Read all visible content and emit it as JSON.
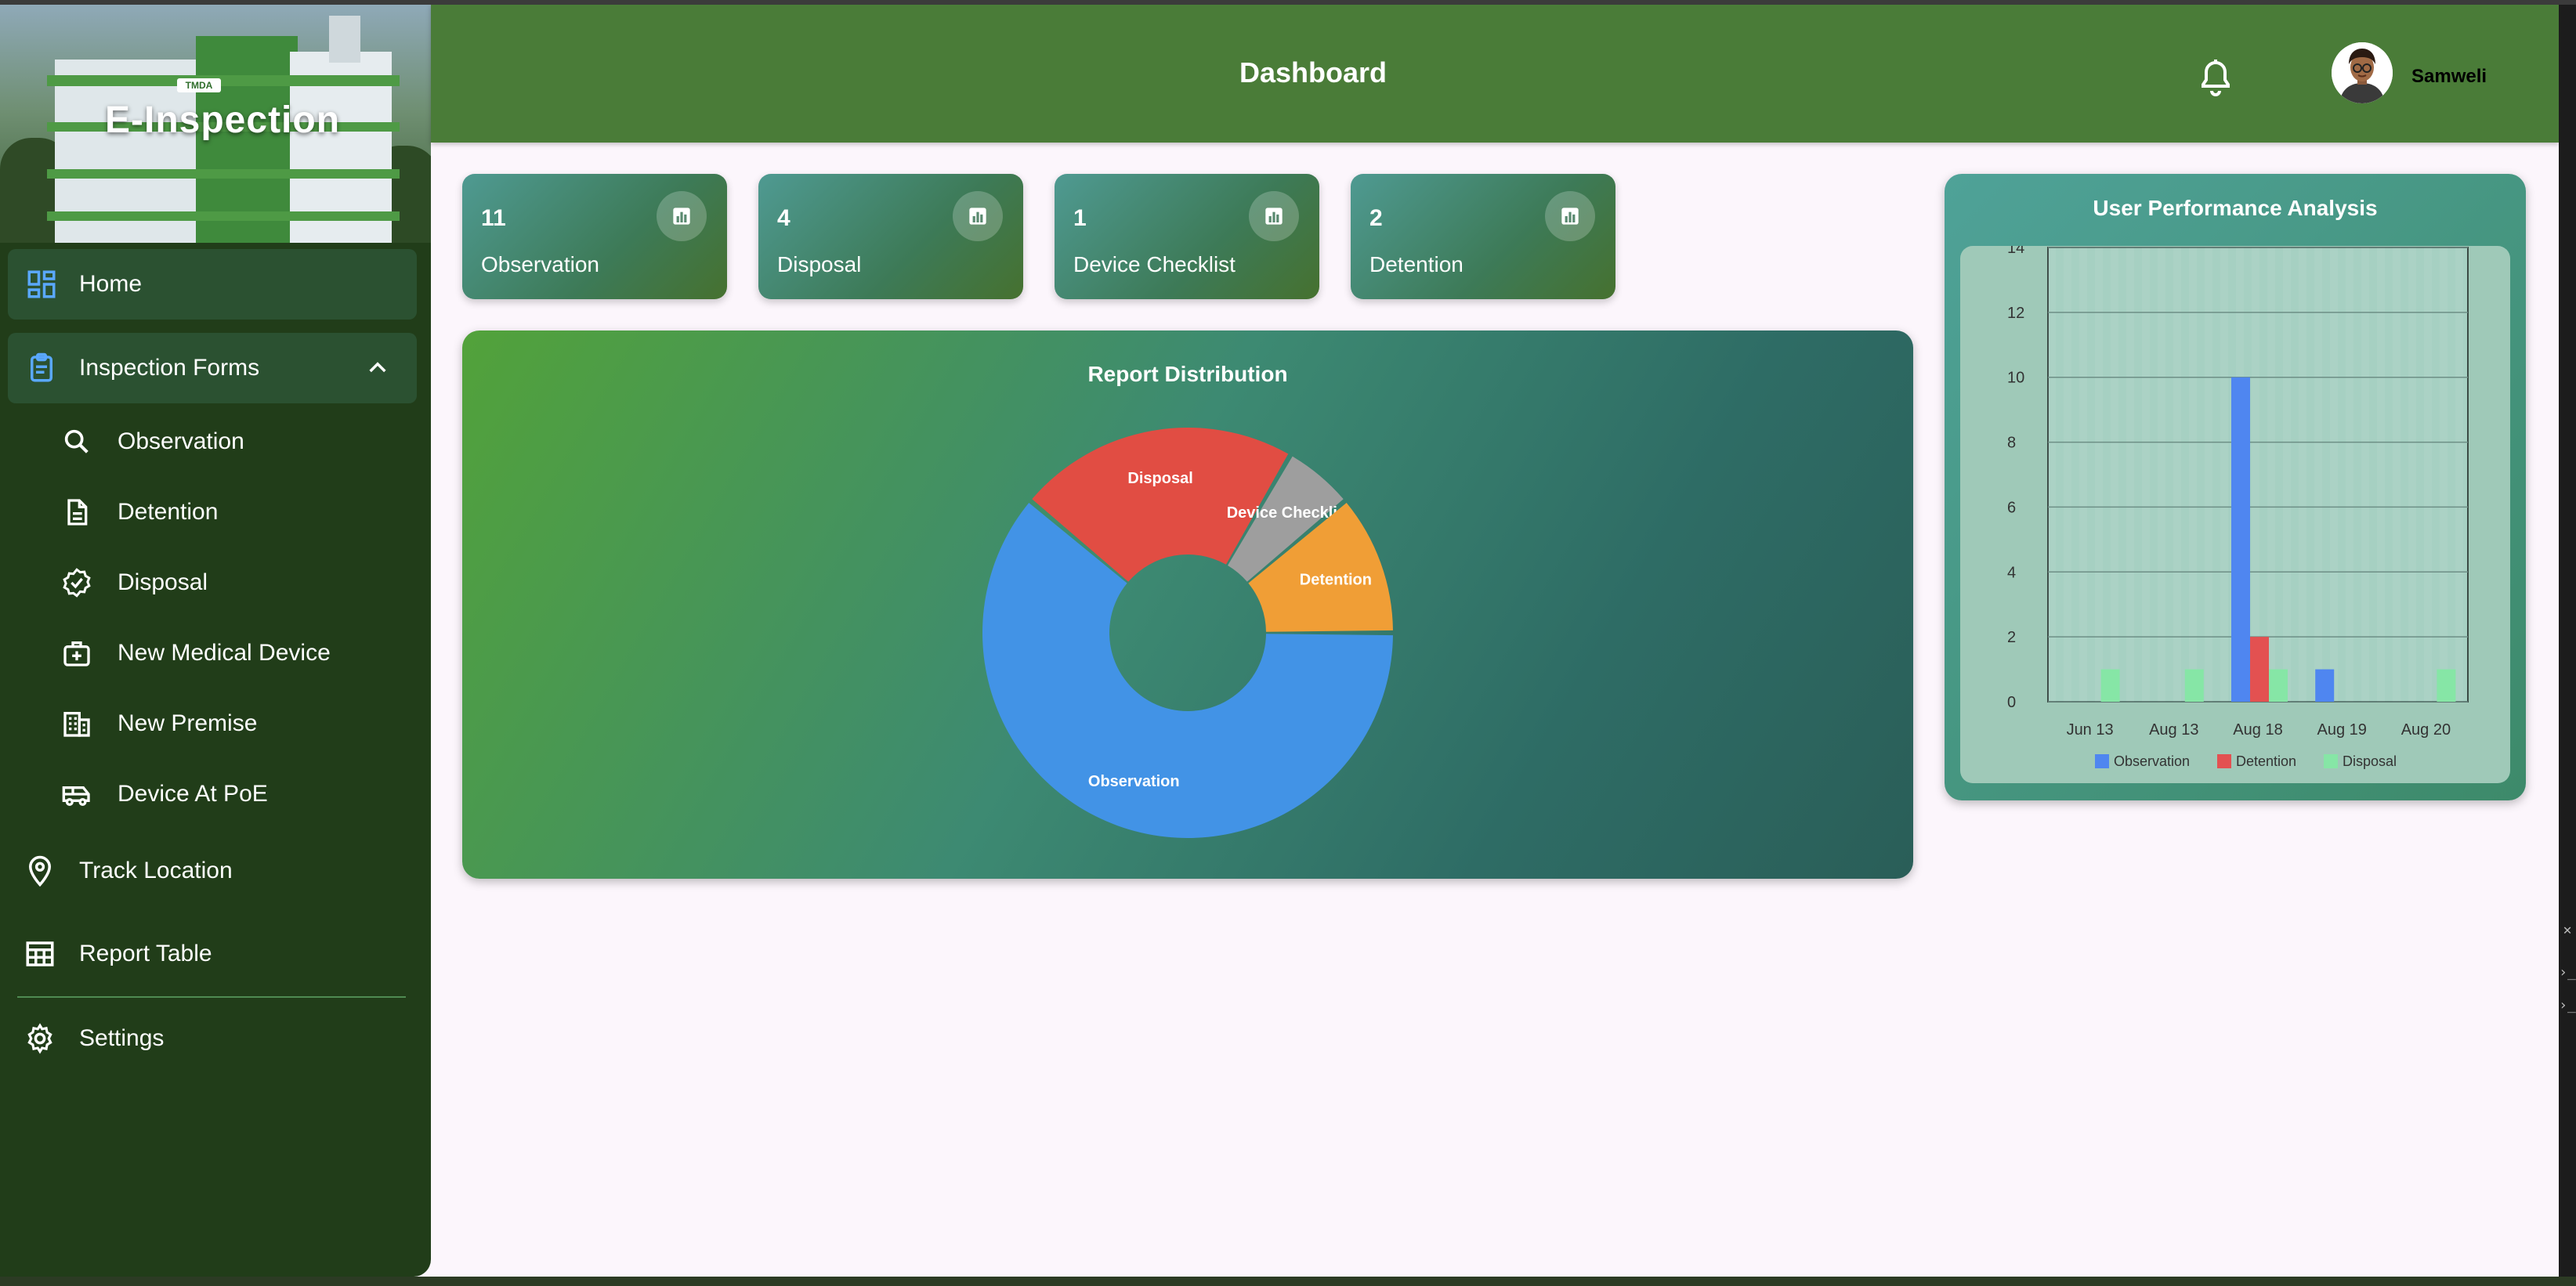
{
  "sidebar": {
    "brand": "E-Inspection",
    "building_sign": "TMDA",
    "home": "Home",
    "inspection_forms": "Inspection Forms",
    "sub_items": [
      "Observation",
      "Detention",
      "Disposal",
      "New Medical Device",
      "New Premise",
      "Device At PoE"
    ],
    "track_location": "Track Location",
    "report_table": "Report Table",
    "settings": "Settings"
  },
  "header": {
    "title": "Dashboard",
    "user_name": "Samweli"
  },
  "cards": [
    {
      "value": "11",
      "label": "Observation"
    },
    {
      "value": "4",
      "label": "Disposal"
    },
    {
      "value": "1",
      "label": "Device Checklist"
    },
    {
      "value": "2",
      "label": "Detention"
    }
  ],
  "chart_data": [
    {
      "type": "pie",
      "title": "Report Distribution",
      "labels": [
        "Observation",
        "Disposal",
        "Device Checklist",
        "Detention"
      ],
      "values": [
        11,
        4,
        1,
        2
      ],
      "colors": [
        "#4293e6",
        "#e14d43",
        "#9e9e9e",
        "#f09e36"
      ],
      "donut": true
    },
    {
      "type": "bar",
      "title": "User Performance Analysis",
      "categories": [
        "Jun 13",
        "Aug 13",
        "Aug 18",
        "Aug 19",
        "Aug 20"
      ],
      "series": [
        {
          "name": "Observation",
          "color": "#4f86f0",
          "values": [
            0,
            0,
            10,
            1,
            0
          ]
        },
        {
          "name": "Detention",
          "color": "#e35151",
          "values": [
            0,
            0,
            2,
            0,
            0
          ]
        },
        {
          "name": "Disposal",
          "color": "#86e6a6",
          "values": [
            1,
            1,
            1,
            0,
            1
          ]
        }
      ],
      "y_ticks": [
        "0",
        "2",
        "4",
        "6",
        "8",
        "10",
        "12",
        "14"
      ],
      "y_max_label": "14",
      "ylim": [
        0,
        14
      ],
      "legend_position": "bottom",
      "grid": true
    }
  ]
}
